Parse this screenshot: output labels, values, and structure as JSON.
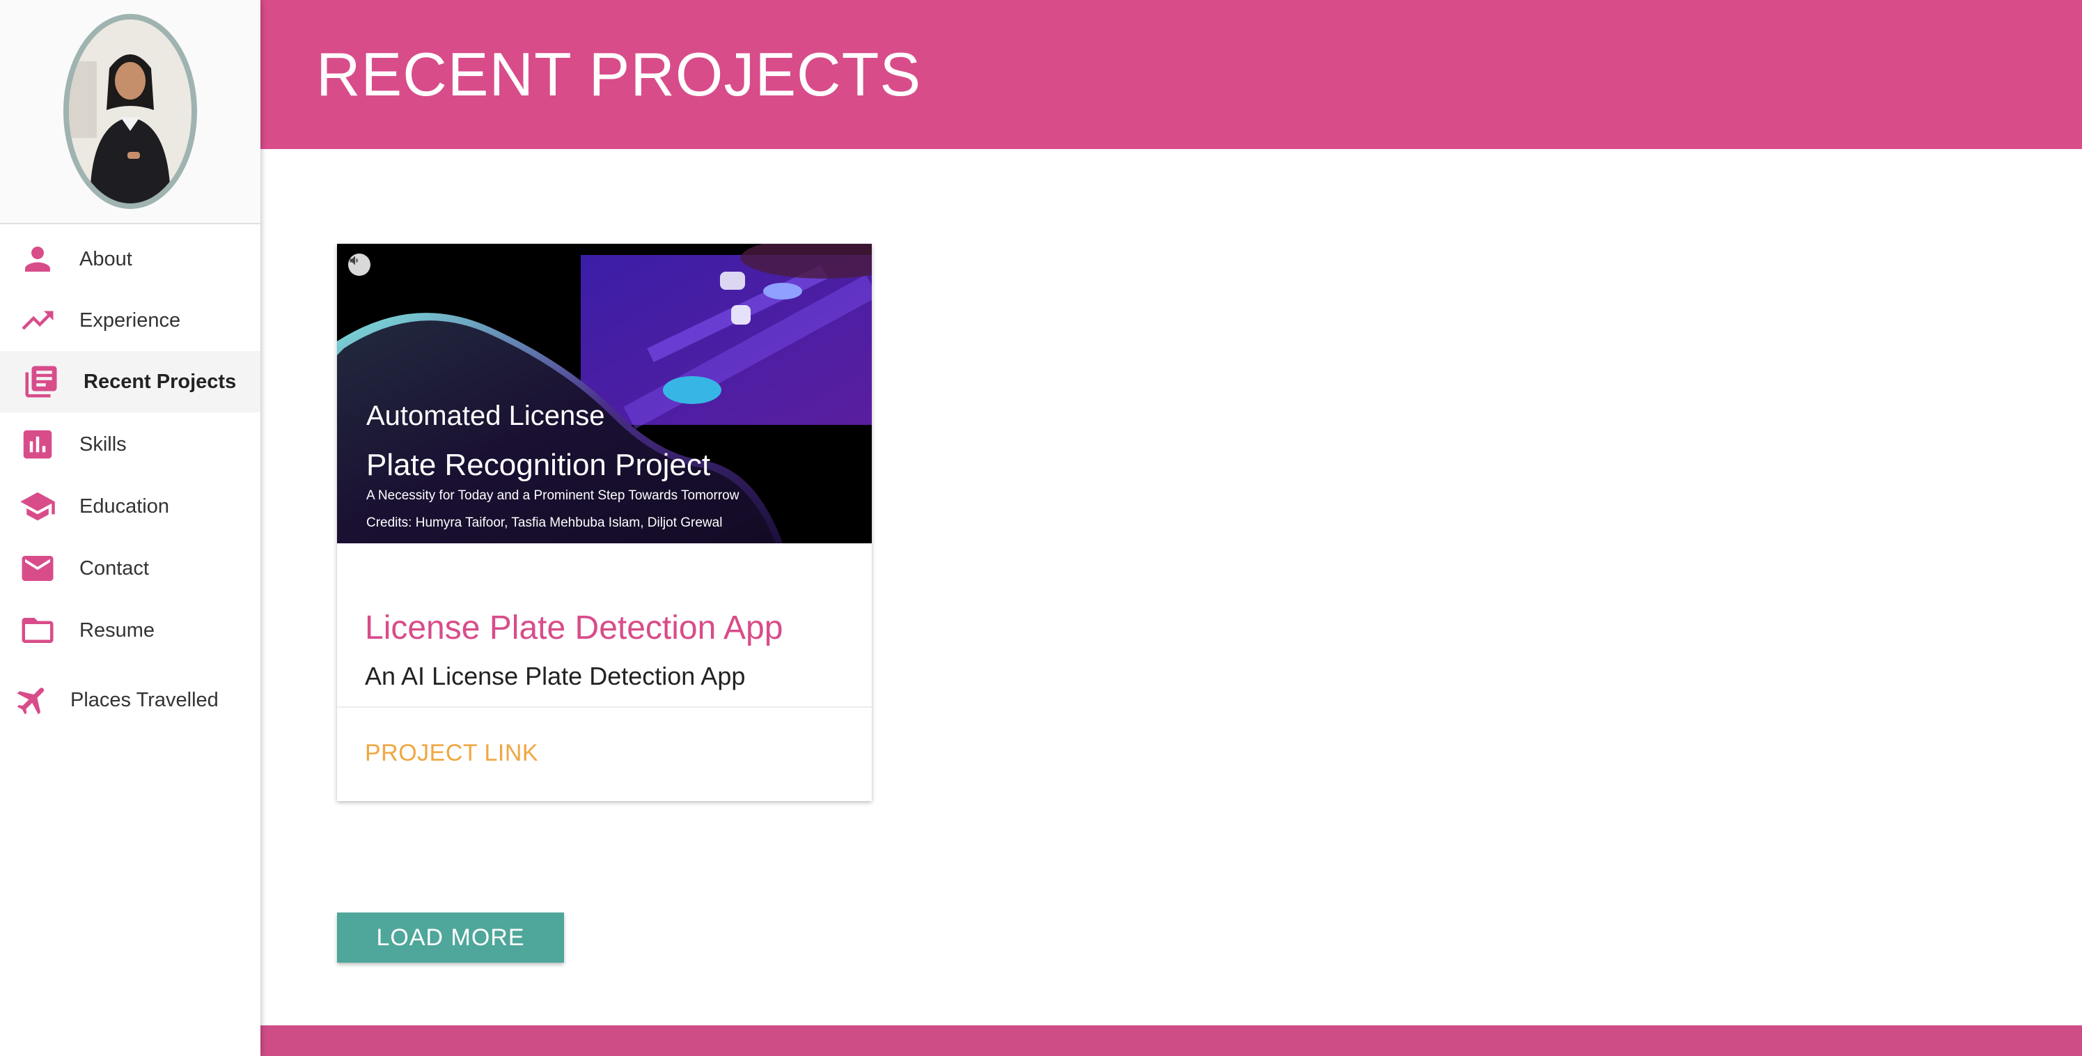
{
  "colors": {
    "accent": "#d84c8a",
    "link": "#f0a742",
    "button": "#4fa69a"
  },
  "header": {
    "title": "RECENT PROJECTS"
  },
  "sidebar": {
    "items": [
      {
        "label": "About",
        "icon": "person-icon"
      },
      {
        "label": "Experience",
        "icon": "trending-up-icon"
      },
      {
        "label": "Recent Projects",
        "icon": "library-books-icon",
        "active": true
      },
      {
        "label": "Skills",
        "icon": "bar-chart-icon"
      },
      {
        "label": "Education",
        "icon": "school-icon"
      },
      {
        "label": "Contact",
        "icon": "mail-icon"
      },
      {
        "label": "Resume",
        "icon": "folder-icon"
      },
      {
        "label": "Places Travelled",
        "icon": "airplane-icon"
      }
    ]
  },
  "project": {
    "image": {
      "line1": "Automated License",
      "line2": "Plate Recognition Project",
      "line3": "A Necessity for Today and a Prominent Step Towards Tomorrow",
      "line4": "Credits: Humyra Taifoor, Tasfia Mehbuba Islam, Diljot Grewal"
    },
    "title": "License Plate Detection App",
    "subtitle": "An AI License Plate Detection App",
    "link_label": "PROJECT LINK"
  },
  "load_more_label": "LOAD MORE"
}
